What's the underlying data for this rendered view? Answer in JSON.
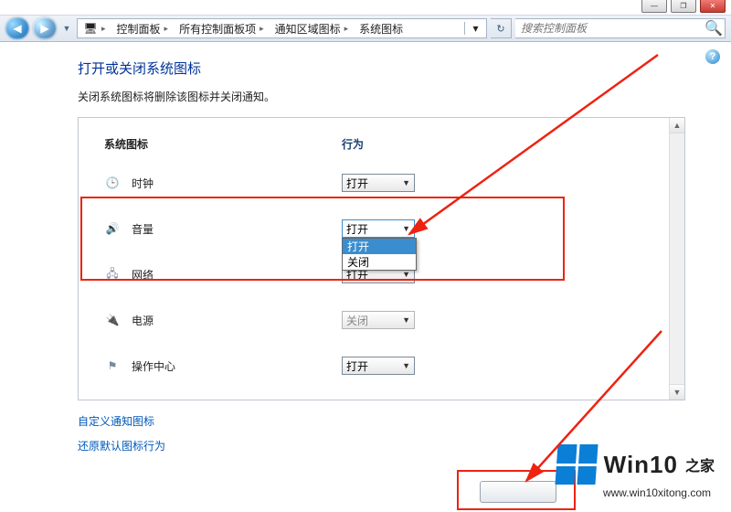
{
  "titlebar": {
    "min": "—",
    "max": "❐",
    "close": "✕"
  },
  "nav": {
    "back": "«",
    "fwd": "»",
    "crumbs": [
      "控制面板",
      "所有控制面板项",
      "通知区域图标",
      "系统图标"
    ],
    "refresh": "↻",
    "dropdown": "▾",
    "search_placeholder": "搜索控制面板",
    "search_icon": "🔍"
  },
  "help": "?",
  "page": {
    "title": "打开或关闭系统图标",
    "subtitle": "关闭系统图标将删除该图标并关闭通知。",
    "col1": "系统图标",
    "col2": "行为",
    "rows": [
      {
        "icon": "clock",
        "icon_glyph": "🕒",
        "label": "时钟",
        "value": "打开",
        "disabled": false,
        "open": false
      },
      {
        "icon": "volume",
        "icon_glyph": "🔊",
        "label": "音量",
        "value": "打开",
        "disabled": false,
        "open": true
      },
      {
        "icon": "network",
        "icon_glyph": "🖧",
        "label": "网络",
        "value": "打开",
        "disabled": false,
        "open": false
      },
      {
        "icon": "power",
        "icon_glyph": "🔌",
        "label": "电源",
        "value": "关闭",
        "disabled": true,
        "open": false
      },
      {
        "icon": "flag",
        "icon_glyph": "⚑",
        "label": "操作中心",
        "value": "打开",
        "disabled": false,
        "open": false
      }
    ],
    "options": [
      "打开",
      "关闭"
    ],
    "link1": "自定义通知图标",
    "link2": "还原默认图标行为"
  },
  "watermark": {
    "brand": "Win10",
    "suffix": "之家",
    "url": "www.win10xitong.com"
  }
}
